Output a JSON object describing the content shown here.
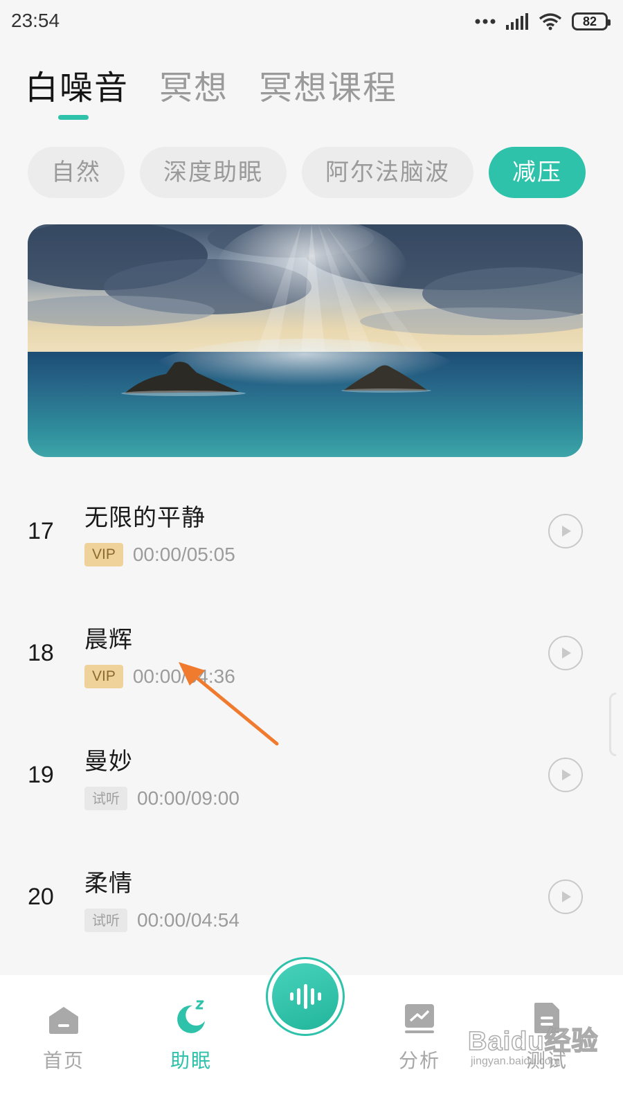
{
  "status_bar": {
    "time": "23:54",
    "battery": "82"
  },
  "tabs": [
    {
      "label": "白噪音",
      "active": true
    },
    {
      "label": "冥想",
      "active": false
    },
    {
      "label": "冥想课程",
      "active": false
    }
  ],
  "categories": [
    {
      "label": "自然",
      "active": false
    },
    {
      "label": "深度助眠",
      "active": false
    },
    {
      "label": "阿尔法脑波",
      "active": false
    },
    {
      "label": "减压",
      "active": true
    }
  ],
  "banner": {
    "scene": "ocean-islands-sunrays"
  },
  "tracks": [
    {
      "number": "17",
      "title": "无限的平静",
      "badge": "VIP",
      "badge_type": "vip",
      "time": "00:00/05:05"
    },
    {
      "number": "18",
      "title": "晨辉",
      "badge": "VIP",
      "badge_type": "vip",
      "time": "00:00/04:36"
    },
    {
      "number": "19",
      "title": "曼妙",
      "badge": "试听",
      "badge_type": "trial",
      "time": "00:00/09:00"
    },
    {
      "number": "20",
      "title": "柔情",
      "badge": "试听",
      "badge_type": "trial",
      "time": "00:00/04:54"
    }
  ],
  "bottom_nav": [
    {
      "label": "首页",
      "icon": "home-icon",
      "active": false
    },
    {
      "label": "助眠",
      "icon": "moon-sleep-icon",
      "active": true
    },
    {
      "label": "分析",
      "icon": "chart-icon",
      "active": false
    },
    {
      "label": "测试",
      "icon": "document-icon",
      "active": false
    }
  ],
  "center_button": {
    "icon": "soundwave-icon"
  },
  "watermark": {
    "logo": "Baidu经验",
    "url": "jingyan.baidu.com"
  },
  "colors": {
    "accent": "#2ec2aa",
    "vip_bg": "#efd29a",
    "arrow": "#f07a2e"
  }
}
